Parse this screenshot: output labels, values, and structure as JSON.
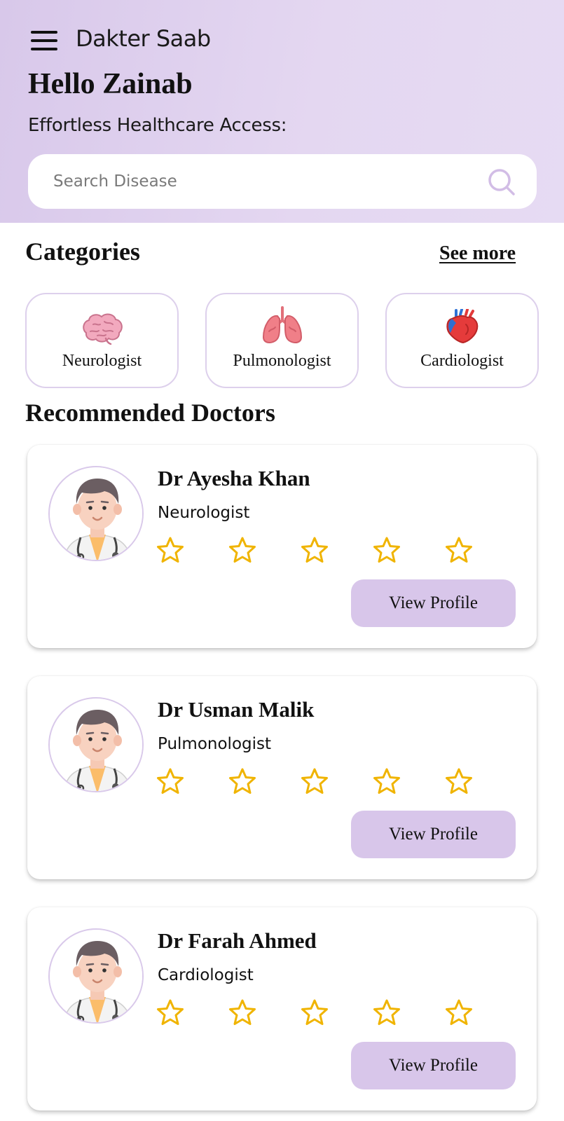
{
  "app": {
    "title": "Dakter Saab"
  },
  "header": {
    "greeting": "Hello Zainab",
    "subtitle": "Effortless Healthcare Access:"
  },
  "search": {
    "placeholder": "Search Disease",
    "value": ""
  },
  "categories": {
    "title": "Categories",
    "see_more": "See more",
    "items": [
      {
        "label": "Neurologist",
        "icon": "brain-icon"
      },
      {
        "label": "Pulmonologist",
        "icon": "lungs-icon"
      },
      {
        "label": "Cardiologist",
        "icon": "heart-icon"
      }
    ]
  },
  "recommended": {
    "title": "Recommended Doctors",
    "doctors": [
      {
        "name": "Dr Ayesha Khan",
        "specialty": "Neurologist",
        "rating": 0,
        "max_rating": 5,
        "button": "View Profile"
      },
      {
        "name": "Dr Usman Malik",
        "specialty": "Pulmonologist",
        "rating": 0,
        "max_rating": 5,
        "button": "View Profile"
      },
      {
        "name": "Dr Farah Ahmed",
        "specialty": "Cardiologist",
        "rating": 0,
        "max_rating": 5,
        "button": "View Profile"
      }
    ]
  },
  "colors": {
    "header_gradient_start": "#d8c8ea",
    "header_gradient_end": "#e6dbf3",
    "accent": "#d8c6ea",
    "star": "#f0b400"
  }
}
